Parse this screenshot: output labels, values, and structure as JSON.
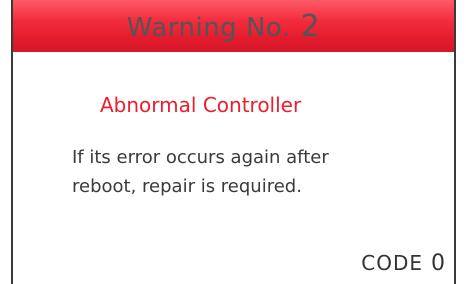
{
  "header": {
    "warning_label": "Warning No.",
    "warning_number": "2"
  },
  "error": {
    "title": "Abnormal Controller",
    "message_lines": [
      "If its error occurs again after",
      "reboot, repair is required."
    ]
  },
  "code": {
    "label": "CODE",
    "value": "0"
  },
  "colors": {
    "header_red": "#e31b2d",
    "title_red": "#ee1c2e",
    "text_gray": "#3a3a3a"
  }
}
